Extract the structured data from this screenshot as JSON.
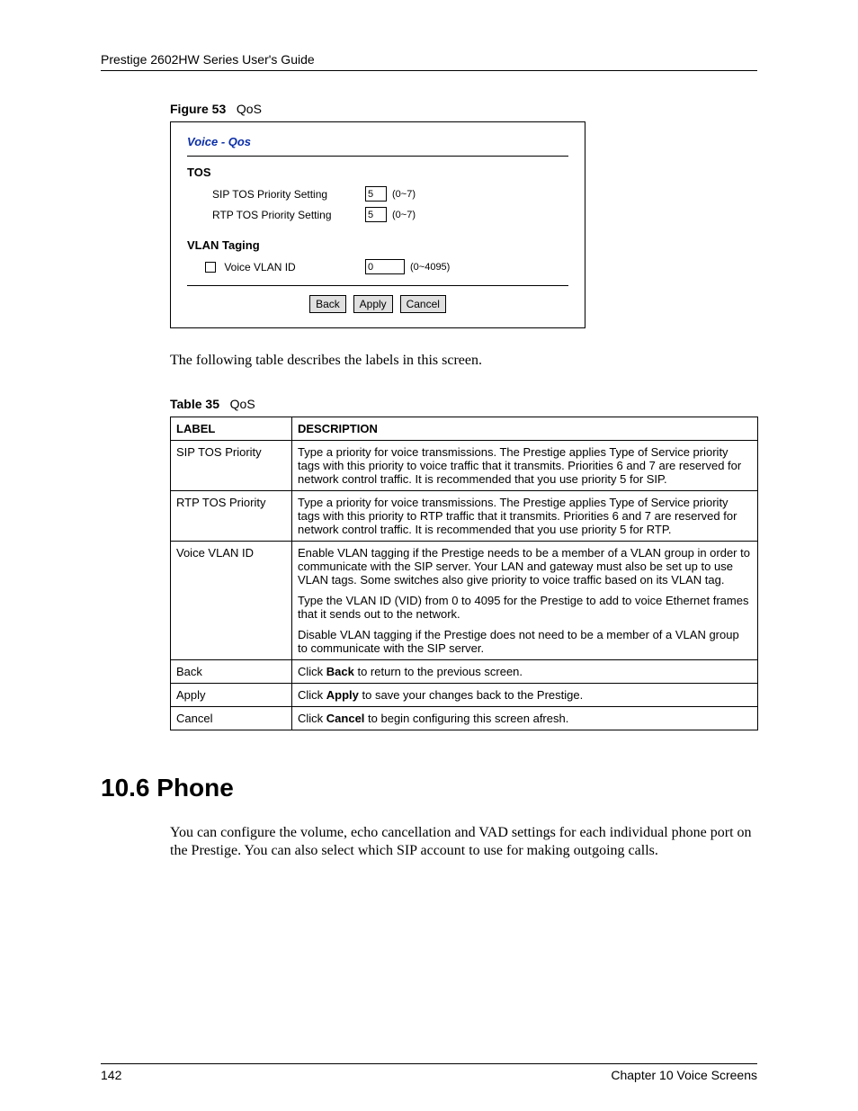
{
  "header": {
    "text": "Prestige 2602HW Series User's Guide"
  },
  "figure": {
    "label_prefix": "Figure 53",
    "label_text": "QoS",
    "title": "Voice - Qos",
    "tos_section": "TOS",
    "sip_label": "SIP TOS Priority Setting",
    "sip_value": "5",
    "sip_range": "(0~7)",
    "rtp_label": "RTP TOS Priority Setting",
    "rtp_value": "5",
    "rtp_range": "(0~7)",
    "vlan_section": "VLAN Taging",
    "vlan_checkbox_label": "Voice VLAN ID",
    "vlan_value": "0",
    "vlan_range": "(0~4095)",
    "btn_back": "Back",
    "btn_apply": "Apply",
    "btn_cancel": "Cancel"
  },
  "intro_para": "The following table describes the labels in this screen.",
  "table": {
    "label_prefix": "Table 35",
    "label_text": "QoS",
    "head_label": "LABEL",
    "head_desc": "DESCRIPTION",
    "rows": [
      {
        "label": "SIP TOS Priority",
        "desc": "Type a priority for voice transmissions. The Prestige applies Type of Service priority tags with this priority to voice traffic that it transmits. Priorities 6 and 7 are reserved for network control traffic. It is recommended that you use priority 5 for SIP."
      },
      {
        "label": "RTP TOS Priority",
        "desc": "Type a priority for voice transmissions. The Prestige applies Type of Service priority tags with this priority to RTP traffic that it transmits. Priorities 6 and 7 are reserved for network control traffic. It is recommended that you use priority 5 for RTP."
      },
      {
        "label": "Voice VLAN ID",
        "desc_p1": "Enable VLAN tagging if the Prestige needs to be a member of a VLAN group in order to communicate with the SIP server. Your LAN and gateway must also be set up to use VLAN tags. Some switches also give priority to voice traffic based on its VLAN tag.",
        "desc_p2": "Type the VLAN ID (VID) from 0 to 4095 for the Prestige to add to voice Ethernet frames that it sends out to the network.",
        "desc_p3": "Disable VLAN tagging if the Prestige does not need to be a member of a VLAN group to communicate with the SIP server."
      },
      {
        "label": "Back",
        "desc_pre": "Click ",
        "desc_bold": "Back",
        "desc_post": " to return to the previous screen."
      },
      {
        "label": "Apply",
        "desc_pre": "Click ",
        "desc_bold": "Apply",
        "desc_post": " to save your changes back to the Prestige."
      },
      {
        "label": "Cancel",
        "desc_pre": "Click ",
        "desc_bold": "Cancel",
        "desc_post": " to begin configuring this screen afresh."
      }
    ]
  },
  "section_heading": "10.6  Phone",
  "section_para": "You can configure the volume, echo cancellation and VAD settings for each individual phone port on the Prestige. You can also select which SIP account to use for making outgoing calls.",
  "footer": {
    "page": "142",
    "chapter": "Chapter 10 Voice Screens"
  }
}
